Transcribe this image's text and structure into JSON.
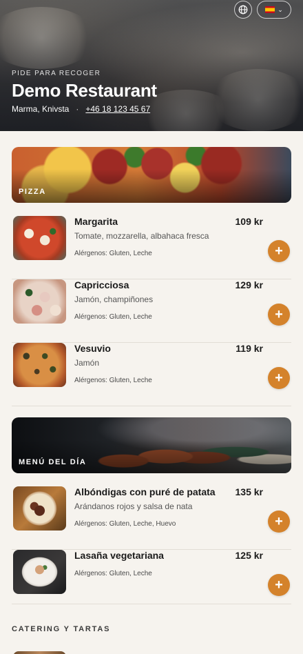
{
  "header": {
    "kicker": "PIDE PARA RECOGER",
    "title": "Demo Restaurant",
    "location": "Marma, Knivsta",
    "separator": "·",
    "phone": "+46 18 123 45 67",
    "language_button_icon": "spain-flag-icon",
    "globe_button_icon": "globe-icon"
  },
  "categories": {
    "pizza": {
      "label": "PIZZA",
      "items": [
        {
          "name": "Margarita",
          "price": "109 kr",
          "description": "Tomate, mozzarella, albahaca fresca",
          "allergens": "Alérgenos: Gluten, Leche"
        },
        {
          "name": "Capricciosa",
          "price": "129 kr",
          "description": "Jamón, champiñones",
          "allergens": "Alérgenos: Gluten, Leche"
        },
        {
          "name": "Vesuvio",
          "price": "119 kr",
          "description": "Jamón",
          "allergens": "Alérgenos: Gluten, Leche"
        }
      ]
    },
    "menu_del_dia": {
      "label": "MENÚ DEL DÍA",
      "items": [
        {
          "name": "Albóndigas con puré de patata",
          "price": "135 kr",
          "description": "Arándanos rojos y salsa de nata",
          "allergens": "Alérgenos: Gluten, Leche, Huevo"
        },
        {
          "name": "Lasaña vegetariana",
          "price": "125 kr",
          "allergens": "Alérgenos: Gluten, Leche"
        }
      ]
    },
    "catering": {
      "label": "CATERING Y TARTAS"
    }
  },
  "add_button_symbol": "+",
  "colors": {
    "accent": "#d4822b",
    "background": "#f6f3ee",
    "text": "#1c1c1c"
  }
}
